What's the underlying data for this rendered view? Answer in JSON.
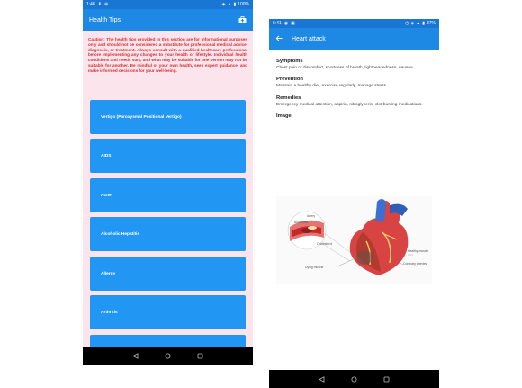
{
  "left_screen": {
    "status_bar": {
      "time": "1:48",
      "battery": "100%"
    },
    "app_bar": {
      "title": "Health Tips",
      "action_icon": "first-aid-kit-icon"
    },
    "caution_text": "Caution: The health tips provided in this section are for informational purposes only and should not be considered a substitute for professional medical advice, diagnosis, or treatment. Always consult with a qualified healthcare professional before implementing any changes to your health or lifestyle. Individual health conditions and needs vary, and what may be suitable for one person may not be suitable for another. Be mindful of your own health, seek expert guidance, and make informed decisions for your well-being.",
    "tips": [
      {
        "label": "Vertigo (Paroxysmal Positional Vertigo)"
      },
      {
        "label": "AIDS"
      },
      {
        "label": "Acne"
      },
      {
        "label": "Alcoholic Hepatitis"
      },
      {
        "label": "Allergy"
      },
      {
        "label": "Arthritis"
      },
      {
        "label": ""
      }
    ]
  },
  "right_screen": {
    "status_bar": {
      "time": "6:41",
      "battery": "87%"
    },
    "app_bar": {
      "title": "Heart attack",
      "back_icon": "arrow-left-icon"
    },
    "sections": {
      "symptoms": {
        "heading": "Symptoms",
        "text": "Chest pain or discomfort, shortness of breath, lightheadedness, nausea."
      },
      "prevention": {
        "heading": "Prevention",
        "text": "Maintain a healthy diet, exercise regularly, manage stress."
      },
      "remedies": {
        "heading": "Remedies",
        "text": "Emergency medical attention, aspirin, nitroglycerin, clot-busting medications."
      },
      "image": {
        "heading": "Image"
      }
    },
    "diagram_labels": {
      "artery": "Artery",
      "blood_clot": "Blood clot",
      "cholesterol": "Cholesterol",
      "dying_muscle": "Dying muscle",
      "healthy_muscle": "Healthy muscle",
      "coronary_arteries": "Coronary arteries"
    }
  },
  "colors": {
    "status_bar": "#1976D2",
    "app_bar": "#1E88E5",
    "tip_button": "#2196F3",
    "list_background": "#FCE4EC",
    "caution_text": "#D32F2F"
  },
  "nav_icons": [
    "back-triangle-icon",
    "home-circle-icon",
    "recents-square-icon"
  ]
}
